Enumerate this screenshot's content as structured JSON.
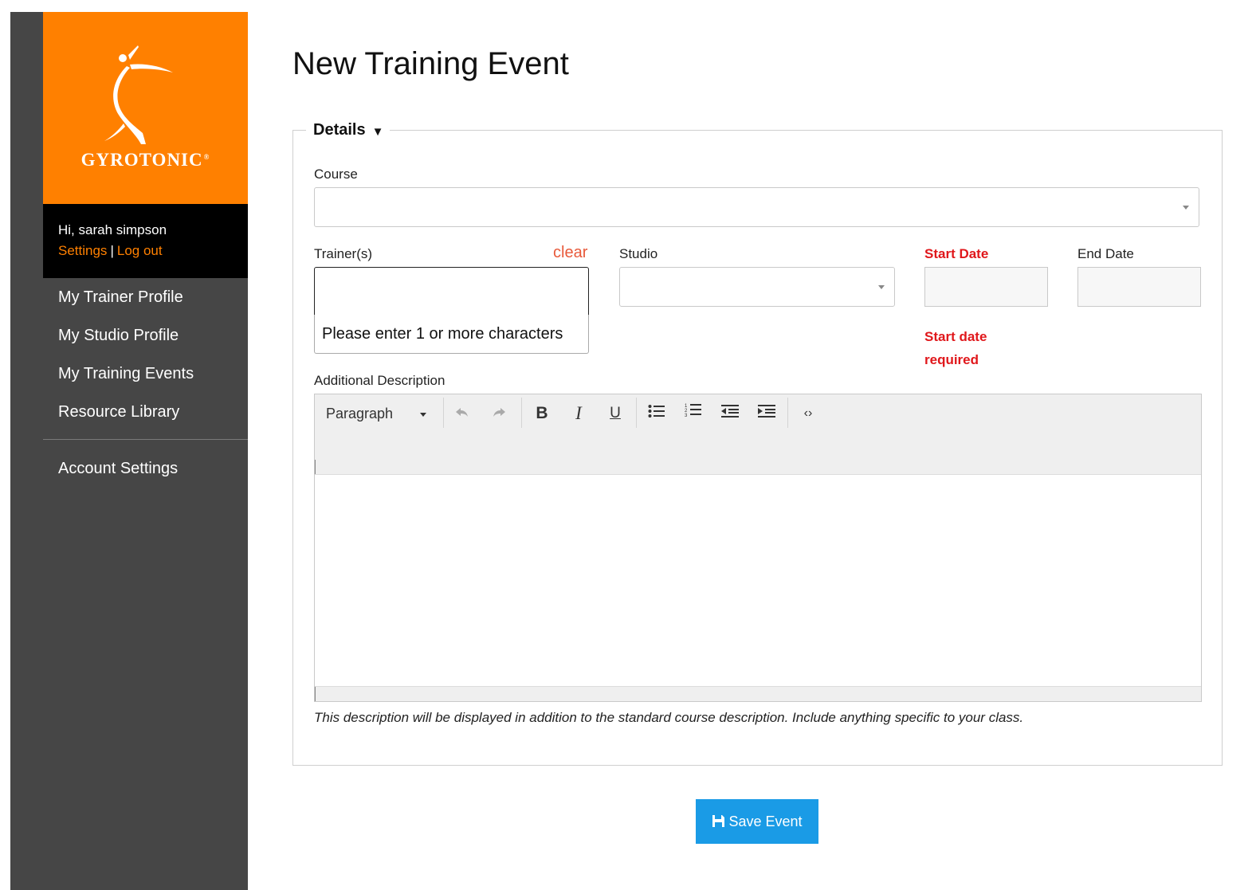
{
  "brand": {
    "name": "GYROTONIC",
    "trademark": "®",
    "color": "#ff8000"
  },
  "user": {
    "greeting": "Hi, sarah simpson",
    "settings_link": "Settings",
    "separator": "|",
    "logout_link": "Log out"
  },
  "sidebar": {
    "items": [
      {
        "label": "My Trainer Profile"
      },
      {
        "label": "My Studio Profile"
      },
      {
        "label": "My Training Events"
      },
      {
        "label": "Resource Library"
      }
    ],
    "account": {
      "label": "Account Settings"
    }
  },
  "page": {
    "title": "New Training Event"
  },
  "details": {
    "legend": "Details",
    "legend_icon": "caret-down-icon",
    "course": {
      "label": "Course",
      "value": ""
    },
    "trainers": {
      "label": "Trainer(s)",
      "clear_label": "clear",
      "value": "",
      "dropdown_hint": "Please enter 1 or more characters"
    },
    "studio": {
      "label": "Studio",
      "value": ""
    },
    "start_date": {
      "label": "Start Date",
      "value": "",
      "error": "Start date required",
      "error_color": "#e0171b"
    },
    "end_date": {
      "label": "End Date",
      "value": ""
    },
    "description": {
      "label": "Additional Description",
      "toolbar": {
        "block_format": "Paragraph",
        "buttons": [
          "undo-icon",
          "redo-icon",
          "bold-icon",
          "italic-icon",
          "underline-icon",
          "bullet-list-icon",
          "numbered-list-icon",
          "outdent-icon",
          "indent-icon",
          "source-code-icon"
        ]
      },
      "help": "This description will be displayed in addition to the standard course description. Include anything specific to your class."
    }
  },
  "actions": {
    "save_label": "Save Event",
    "save_icon": "save-icon",
    "save_color": "#1a9be6"
  }
}
